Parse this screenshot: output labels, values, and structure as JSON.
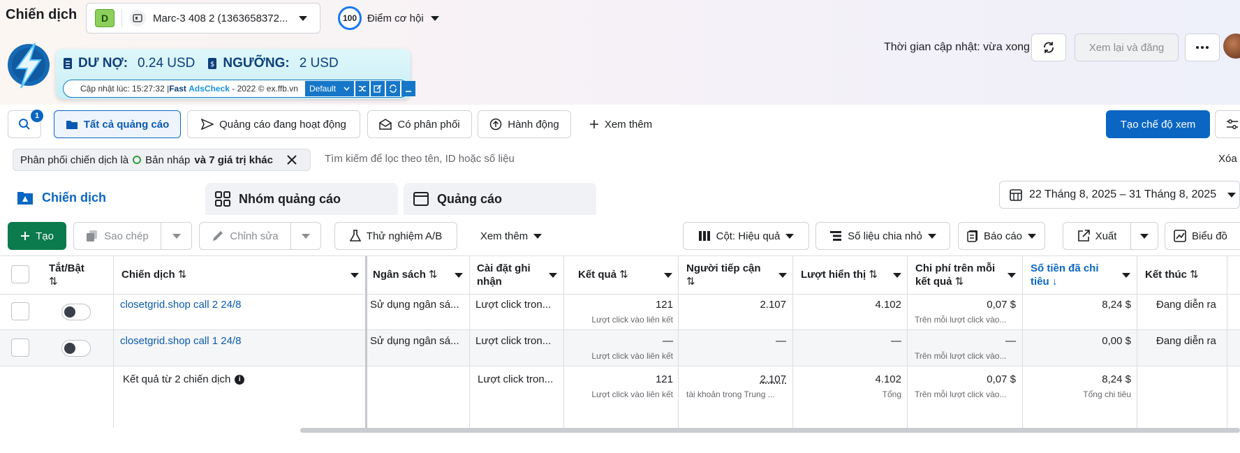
{
  "header": {
    "title": "Chiến dịch",
    "account_initial": "D",
    "account_name": "Marc-3 408 2 (1363658372...",
    "opportunity_score": "100",
    "opportunity_label": "Điểm cơ hội",
    "update_time": "Thời gian cập nhật: vừa xong",
    "review_button": "Xem lại và đăng"
  },
  "adscheck": {
    "debt_label": "DƯ NỢ:",
    "debt_value": "0.24 USD",
    "threshold_label": "NGƯỠNG:",
    "threshold_value": "2 USD",
    "footer_prefix": "Cập nhật lúc: 15:27:32 | ",
    "brand_fast": "Fast ",
    "brand_name": "AdsCheck",
    "footer_suffix": " - 2022 © ex.ffb.vn",
    "mode": "Default"
  },
  "filters": {
    "search_badge": "1",
    "all_ads": "Tất cả quảng cáo",
    "active_ads": "Quảng cáo đang hoạt động",
    "has_delivery": "Có phân phối",
    "actions": "Hành động",
    "more": "Xem thêm",
    "create_view": "Tạo chế độ xem"
  },
  "filter_bar": {
    "chip_prefix": "Phân phối chiến dịch là",
    "chip_value": "Bản nháp",
    "chip_more": "và 7 giá trị khác",
    "search_placeholder": "Tìm kiếm để lọc theo tên, ID hoặc số liệu",
    "clear": "Xóa"
  },
  "tabs": [
    {
      "label": "Chiến dịch"
    },
    {
      "label": "Nhóm quảng cáo"
    },
    {
      "label": "Quảng cáo"
    }
  ],
  "date_range": "22 Tháng 8, 2025 – 31 Tháng 8, 2025",
  "toolbar": {
    "create": "Tạo",
    "copy": "Sao chép",
    "edit": "Chỉnh sửa",
    "ab_test": "Thử nghiệm A/B",
    "more": "Xem thêm",
    "columns": "Cột: Hiệu quả",
    "breakdown": "Số liệu chia nhỏ",
    "reports": "Báo cáo",
    "export": "Xuất",
    "chart": "Biểu đồ"
  },
  "table": {
    "headers": {
      "toggle": "Tắt/Bật",
      "campaign": "Chiến dịch",
      "budget": "Ngân sách",
      "attribution": "Cài đặt ghi nhận",
      "results": "Kết quả",
      "reach": "Người tiếp cận",
      "impressions": "Lượt hiển thị",
      "cost_per_result": "Chi phí trên mỗi kết quả",
      "amount_spent": "Số tiền đã chi tiêu",
      "ends": "Kết thúc"
    },
    "rows": [
      {
        "name": "closetgrid.shop call 2 24/8",
        "budget": "Sử dụng ngân sá...",
        "attribution": "Lượt click tron...",
        "results": "121",
        "results_sub": "Lượt click vào liên kết",
        "reach": "2.107",
        "impressions": "4.102",
        "cpr": "0,07 $",
        "cpr_sub": "Trên mỗi lượt click vào...",
        "spent": "8,24 $",
        "ends": "Đang diễn ra"
      },
      {
        "name": "closetgrid.shop call 1 24/8",
        "budget": "Sử dụng ngân sá...",
        "attribution": "Lượt click tron...",
        "results": "—",
        "results_sub": "Lượt click vào liên kết",
        "reach": "—",
        "impressions": "—",
        "cpr": "—",
        "cpr_sub": "Trên mỗi lượt click vào...",
        "spent": "0,00 $",
        "ends": "Đang diễn ra"
      }
    ],
    "summary": {
      "label": "Kết quả từ 2 chiến dịch",
      "attribution": "Lượt click tron...",
      "results": "121",
      "results_sub": "Lượt click vào liên kết",
      "reach": "2.107",
      "reach_sub": "tài khoản trong Trung ...",
      "impressions": "4.102",
      "impressions_sub": "Tổng",
      "cpr": "0,07 $",
      "cpr_sub": "Trên mỗi lượt click vào...",
      "spent": "8,24 $",
      "spent_sub": "Tổng chi tiêu"
    }
  },
  "colors": {
    "primary": "#0a66c2",
    "create_green": "#0b7a4d",
    "link": "#0a5ab0"
  }
}
